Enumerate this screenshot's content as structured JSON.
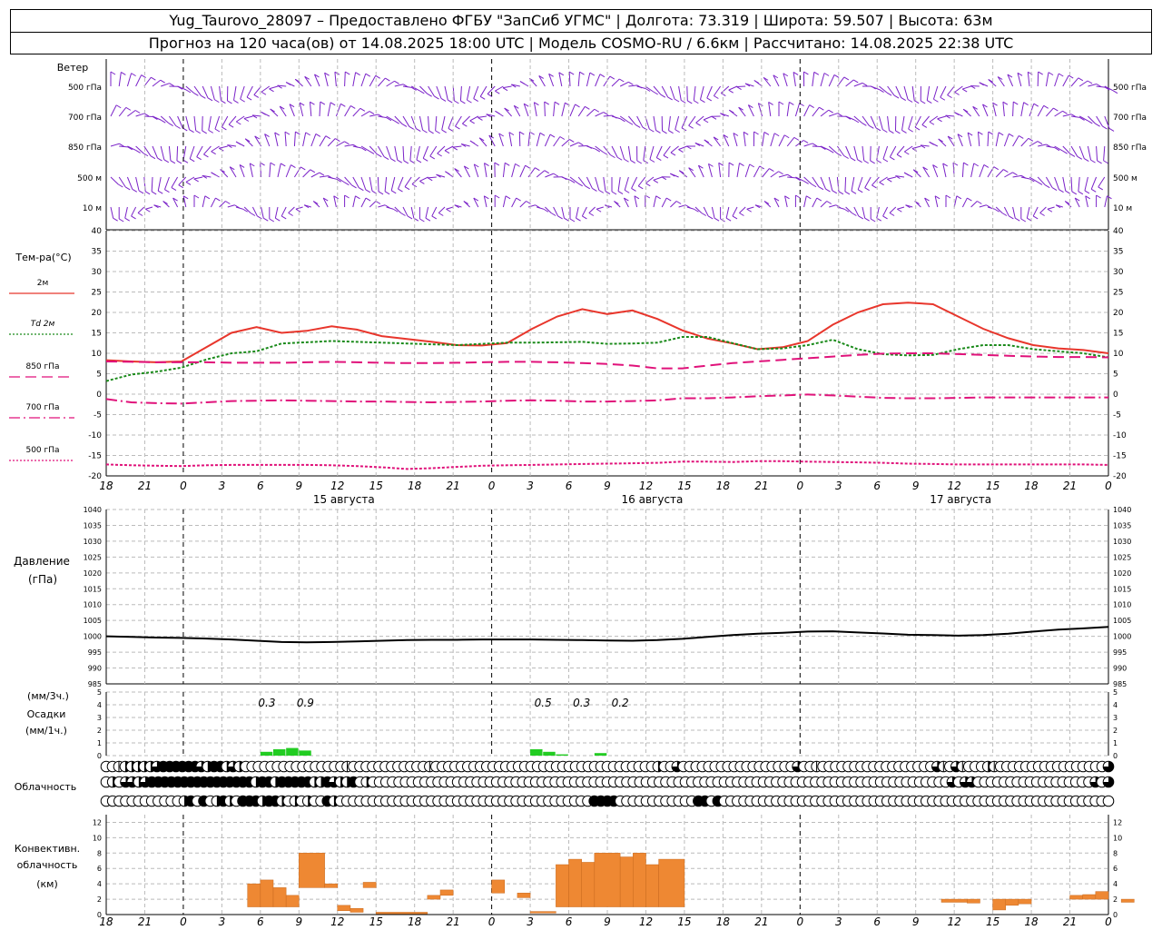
{
  "header": {
    "line1": "Yug_Taurovo_28097 – Предоставлено ФГБУ \"ЗапСиб УГМС\" | Долгота: 73.319 | Широта: 59.507 | Высота: 63м",
    "line2": "Прогноз на 120 часа(ов) от 14.08.2025 18:00 UTC  | Модель COSMO-RU / 6.6км | Рассчитано: 14.08.2025 22:38 UTC"
  },
  "colors": {
    "t2m": "#e8362c",
    "td": "#1a8a1a",
    "iso": "#e0127a",
    "wind": "#7a22c8",
    "pres": "#000000",
    "precip": "#22cc22",
    "conv": "#ee8833"
  },
  "chart_data": [
    {
      "type": "wind_barbs",
      "panel_label": "Ветер",
      "levels": [
        "500 гПа",
        "700 гПа",
        "850 гПа",
        "500 м",
        "10 м"
      ],
      "x_hours": [
        18,
        21,
        0,
        3,
        6,
        9,
        12,
        15,
        18,
        21,
        0,
        3,
        6,
        9,
        12,
        15,
        18,
        21,
        0,
        3,
        6,
        9,
        12,
        15,
        18,
        21,
        0,
        3,
        6,
        9,
        12,
        15,
        18,
        21,
        0,
        3,
        6,
        9,
        12,
        15,
        18,
        21,
        0
      ]
    },
    {
      "type": "line",
      "panel_label": "Тем-ра(°C)",
      "ylim": [
        -20,
        40
      ],
      "yticks": [
        -20,
        -15,
        -10,
        -5,
        0,
        5,
        10,
        15,
        20,
        25,
        30,
        35,
        40
      ],
      "x_ticks": [
        "18",
        "21",
        "0",
        "3",
        "6",
        "9",
        "12",
        "15",
        "18",
        "21",
        "0",
        "3",
        "6",
        "9",
        "12",
        "15",
        "18",
        "21",
        "0",
        "3",
        "6",
        "9",
        "12",
        "15",
        "18",
        "21",
        "0"
      ],
      "day_labels": [
        "15 августа",
        "16 августа",
        "17 августа"
      ],
      "x_lead_hours": [
        0,
        3,
        6,
        9,
        12,
        15,
        18,
        21,
        24,
        27,
        30,
        33,
        36,
        39,
        42,
        45,
        48,
        51,
        54,
        57,
        60,
        63,
        66,
        69,
        72,
        75,
        78,
        81,
        84,
        87,
        90,
        93,
        96,
        99,
        102,
        105,
        108,
        111,
        114,
        117,
        120
      ],
      "series": [
        {
          "name": "2м",
          "style": "solid",
          "color": "#e8362c",
          "values": [
            8.3,
            8,
            7.8,
            8,
            11.5,
            15,
            16.4,
            15,
            15.5,
            16.6,
            15.8,
            14.2,
            13.5,
            12.8,
            12,
            11.9,
            12.5,
            16,
            19,
            20.8,
            19.6,
            20.5,
            18.4,
            15.6,
            13.6,
            12.4,
            11,
            11.5,
            13,
            17,
            20,
            22,
            22.4,
            22,
            19,
            16,
            13.7,
            12,
            11.2,
            10.8,
            10
          ]
        },
        {
          "name": "Td  2м",
          "style": "dotted",
          "color": "#1a8a1a",
          "values": [
            3.2,
            4.8,
            5.5,
            6.5,
            8.5,
            10,
            10.5,
            12.4,
            12.7,
            13,
            12.8,
            12.6,
            12.4,
            12.2,
            12,
            12.3,
            12.6,
            12.6,
            12.7,
            12.8,
            12.3,
            12.4,
            12.6,
            14,
            14,
            12.5,
            11,
            11.2,
            12,
            13.3,
            11,
            9.8,
            9.5,
            9.6,
            11,
            12,
            12,
            11,
            10.5,
            10,
            9
          ]
        },
        {
          "name": "850 гПа",
          "style": "dash",
          "color": "#e0127a",
          "values": [
            8,
            7.9,
            7.8,
            7.8,
            7.8,
            7.7,
            7.7,
            7.7,
            7.8,
            7.9,
            7.8,
            7.7,
            7.6,
            7.6,
            7.7,
            7.8,
            7.9,
            7.9,
            7.8,
            7.6,
            7.4,
            7,
            6.3,
            6.3,
            7,
            7.6,
            8,
            8.4,
            8.8,
            9.2,
            9.6,
            9.9,
            10,
            10,
            9.8,
            9.6,
            9.4,
            9.2,
            9.1,
            9.1,
            9
          ]
        },
        {
          "name": "700 гПа",
          "style": "dashdot",
          "color": "#e0127a",
          "values": [
            -1.2,
            -2,
            -2.2,
            -2.3,
            -2,
            -1.7,
            -1.6,
            -1.5,
            -1.6,
            -1.7,
            -1.8,
            -1.8,
            -1.9,
            -2,
            -1.9,
            -1.8,
            -1.6,
            -1.5,
            -1.6,
            -1.8,
            -1.8,
            -1.7,
            -1.5,
            -1,
            -1,
            -0.8,
            -0.5,
            -0.3,
            -0.1,
            -0.3,
            -0.6,
            -0.9,
            -1,
            -1,
            -0.9,
            -0.8,
            -0.8,
            -0.8,
            -0.8,
            -0.8,
            -0.8
          ]
        },
        {
          "name": "500 гПа",
          "style": "dotted",
          "color": "#e0127a",
          "values": [
            -17.2,
            -17.4,
            -17.5,
            -17.6,
            -17.4,
            -17.3,
            -17.3,
            -17.3,
            -17.3,
            -17.4,
            -17.6,
            -17.9,
            -18.3,
            -18.1,
            -17.8,
            -17.5,
            -17.4,
            -17.3,
            -17.2,
            -17.1,
            -17,
            -16.9,
            -16.8,
            -16.5,
            -16.5,
            -16.6,
            -16.4,
            -16.4,
            -16.5,
            -16.6,
            -16.7,
            -16.8,
            -17,
            -17.1,
            -17.2,
            -17.2,
            -17.2,
            -17.2,
            -17.2,
            -17.2,
            -17.3
          ]
        }
      ]
    },
    {
      "type": "line",
      "panel_label": [
        "Давление",
        "(гПа)"
      ],
      "ylim": [
        985,
        1040
      ],
      "yticks": [
        985,
        990,
        995,
        1000,
        1005,
        1010,
        1015,
        1020,
        1025,
        1030,
        1035,
        1040
      ],
      "x_lead_hours": [
        0,
        3,
        6,
        9,
        12,
        15,
        18,
        21,
        24,
        27,
        30,
        33,
        36,
        39,
        42,
        45,
        48,
        51,
        54,
        57,
        60,
        63,
        66,
        69,
        72,
        75,
        78,
        81,
        84,
        87,
        90,
        93,
        96,
        99,
        102,
        105,
        108,
        111,
        114,
        117,
        120
      ],
      "series": [
        {
          "name": "",
          "values": [
            1000,
            999.8,
            999.6,
            999.5,
            999.3,
            999,
            998.6,
            998.2,
            998.1,
            998.2,
            998.4,
            998.6,
            998.8,
            998.9,
            998.9,
            999,
            999,
            999,
            998.9,
            998.8,
            998.7,
            998.6,
            998.8,
            999.2,
            999.8,
            1000.4,
            1000.8,
            1001.1,
            1001.5,
            1001.6,
            1001.2,
            1000.9,
            1000.5,
            1000.4,
            1000.2,
            1000.4,
            1000.8,
            1001.5,
            1002.1,
            1002.5,
            1003
          ]
        }
      ]
    },
    {
      "type": "bar",
      "panel_label": [
        "(мм/3ч.)",
        "Осадки",
        "(мм/1ч.)"
      ],
      "ylim": [
        0,
        5
      ],
      "yticks": [
        0,
        1,
        2,
        3,
        4,
        5
      ],
      "annotations": [
        {
          "text": "0.3",
          "x_lead": 12.5
        },
        {
          "text": "0.9",
          "x_lead": 15.5
        },
        {
          "text": "0.5",
          "x_lead": 34
        },
        {
          "text": "0.3",
          "x_lead": 37
        },
        {
          "text": "0.2",
          "x_lead": 40
        }
      ],
      "bars": [
        {
          "x_lead": 12.5,
          "value": 0.3
        },
        {
          "x_lead": 13.5,
          "value": 0.5
        },
        {
          "x_lead": 14.5,
          "value": 0.6
        },
        {
          "x_lead": 15.5,
          "value": 0.4
        },
        {
          "x_lead": 33.5,
          "value": 0.5
        },
        {
          "x_lead": 34.5,
          "value": 0.3
        },
        {
          "x_lead": 35.5,
          "value": 0.1
        },
        {
          "x_lead": 38.5,
          "value": 0.2
        }
      ]
    },
    {
      "type": "cloud_cover",
      "panel_label": "Облачность",
      "rows": [
        "0 0 1 2 2 2 2 2 3 4 4 4 4 4 4 3 2 4 4 2 3 2 0 0 0 0 0 0 0 0 0 0 0 0 0 0 0 0 1 0 0 0 0 0 0 0 0 0 0 0 0 1 0 0 0 0 0 0 0 0 0 0 0 0 0 0 0 0 0 0 0 0 0 0 0 0 0 0 0 0 0 0 0 0 0 0 0 2 0 0 3 0 0 0 0 0 0 0 0 0 0 0 0 0 0 0 0 0 0 3 0 0 1 0 0 0 0 0 0 0 0 0 0 0 0 0 0 0 0 0 0 3 1 0 3 1 0 0 0 2 1 0 0 0 0 0 0 0 0 0 0 0 0 0 0 0 0 0 3",
        "0 2 0 3 3 2 3 4 4 4 4 4 4 4 4 4 4 4 4 4 4 4 4 2 4 4 2 4 4 4 4 4 2 2 4 3 2 2 4 0 2 0 0 0 0 0 0 0 0 0 0 0 0 0 0 0 0 0 0 0 0 0 0 0 0 0 0 0 0 0 0 0 0 0 0 0 0 0 0 0 0 0 0 0 0 0 0 0 0 0 0 0 0 0 0 0 0 0 0 0 0 0 0 0 0 0 0 0 0 0 0 0 0 0 0 0 0 0 0 0 0 0 0 0 0 0 0 0 0 0 3 0 3 3 0 0 0 0 0 0 0 0 0 0 0 0 0 0 0 0 0 0 3 0 3",
        "0 0 0 0 0 0 0 0 0 0 0 0 2 4 0 4 0 2 4 2 0 4 4 4 2 4 4 2 0 2 0 2 0 0 4 2 0 0 0 0 0 0 0 0 0 0 0 0 0 0 0 0 0 0 0 0 0 0 0 0 0 0 0 0 0 0 0 0 0 0 0 0 0 0 0 4 4 4 4 0 0 0 0 0 0 0 0 0 0 0 0 4 4 0 4 0 0 0 0 0 0 0 0 0 0 0 0 0 0 0 0 0 0 0 0 0 0 0 0 0 0 0 0 0 0 0 0 0 0 0 0 0 0 0 0 0 0 0 0 0 0 0 0 0 0 0 0 0 0 0 0 0 0 0 0"
      ]
    },
    {
      "type": "bar",
      "panel_label": [
        "Конвективн.",
        "облачность",
        "(км)"
      ],
      "ylim": [
        0,
        13
      ],
      "yticks": [
        0,
        2,
        4,
        6,
        8,
        10,
        12
      ],
      "x_ticks": [
        "18",
        "21",
        "0",
        "3",
        "6",
        "9",
        "12",
        "15",
        "18",
        "21",
        "0",
        "3",
        "6",
        "9",
        "12",
        "15",
        "18",
        "21",
        "0",
        "3",
        "6",
        "9",
        "12",
        "15",
        "18",
        "21",
        "0"
      ],
      "ranges": [
        {
          "x0": 11,
          "x1": 12,
          "bottom": 1,
          "top": 4
        },
        {
          "x0": 12,
          "x1": 13,
          "bottom": 1,
          "top": 4.5
        },
        {
          "x0": 13,
          "x1": 14,
          "bottom": 1,
          "top": 3.5
        },
        {
          "x0": 14,
          "x1": 15,
          "bottom": 1,
          "top": 2.5
        },
        {
          "x0": 15,
          "x1": 17,
          "bottom": 3.5,
          "top": 8
        },
        {
          "x0": 17,
          "x1": 18,
          "bottom": 3.5,
          "top": 4
        },
        {
          "x0": 18,
          "x1": 19,
          "bottom": 0.5,
          "top": 1.2
        },
        {
          "x0": 19,
          "x1": 20,
          "bottom": 0.3,
          "top": 0.8
        },
        {
          "x0": 20,
          "x1": 21,
          "bottom": 3.5,
          "top": 4.2
        },
        {
          "x0": 21,
          "x1": 25,
          "bottom": 0.1,
          "top": 0.3
        },
        {
          "x0": 25,
          "x1": 26,
          "bottom": 2,
          "top": 2.5
        },
        {
          "x0": 26,
          "x1": 27,
          "bottom": 2.5,
          "top": 3.2
        },
        {
          "x0": 30,
          "x1": 31,
          "bottom": 2.8,
          "top": 4.5
        },
        {
          "x0": 32,
          "x1": 33,
          "bottom": 2.2,
          "top": 2.8
        },
        {
          "x0": 33,
          "x1": 35,
          "bottom": 0.2,
          "top": 0.4
        },
        {
          "x0": 35,
          "x1": 36,
          "bottom": 1,
          "top": 6.5
        },
        {
          "x0": 36,
          "x1": 37,
          "bottom": 1,
          "top": 7.2
        },
        {
          "x0": 37,
          "x1": 38,
          "bottom": 1,
          "top": 6.8
        },
        {
          "x0": 38,
          "x1": 40,
          "bottom": 1,
          "top": 8
        },
        {
          "x0": 40,
          "x1": 41,
          "bottom": 1,
          "top": 7.5
        },
        {
          "x0": 41,
          "x1": 42,
          "bottom": 1,
          "top": 8
        },
        {
          "x0": 42,
          "x1": 43,
          "bottom": 1,
          "top": 6.5
        },
        {
          "x0": 43,
          "x1": 45,
          "bottom": 1,
          "top": 7.2
        },
        {
          "x0": 65,
          "x1": 67,
          "bottom": 1.6,
          "top": 2
        },
        {
          "x0": 67,
          "x1": 68,
          "bottom": 1.5,
          "top": 2
        },
        {
          "x0": 69,
          "x1": 70,
          "bottom": 0.6,
          "top": 2
        },
        {
          "x0": 70,
          "x1": 71,
          "bottom": 1.2,
          "top": 2
        },
        {
          "x0": 71,
          "x1": 72,
          "bottom": 1.4,
          "top": 2
        },
        {
          "x0": 75,
          "x1": 76,
          "bottom": 2,
          "top": 2.5
        },
        {
          "x0": 76,
          "x1": 77,
          "bottom": 2,
          "top": 2.6
        },
        {
          "x0": 77,
          "x1": 78,
          "bottom": 2,
          "top": 3
        },
        {
          "x0": 79,
          "x1": 80,
          "bottom": 1.6,
          "top": 2
        }
      ]
    }
  ]
}
